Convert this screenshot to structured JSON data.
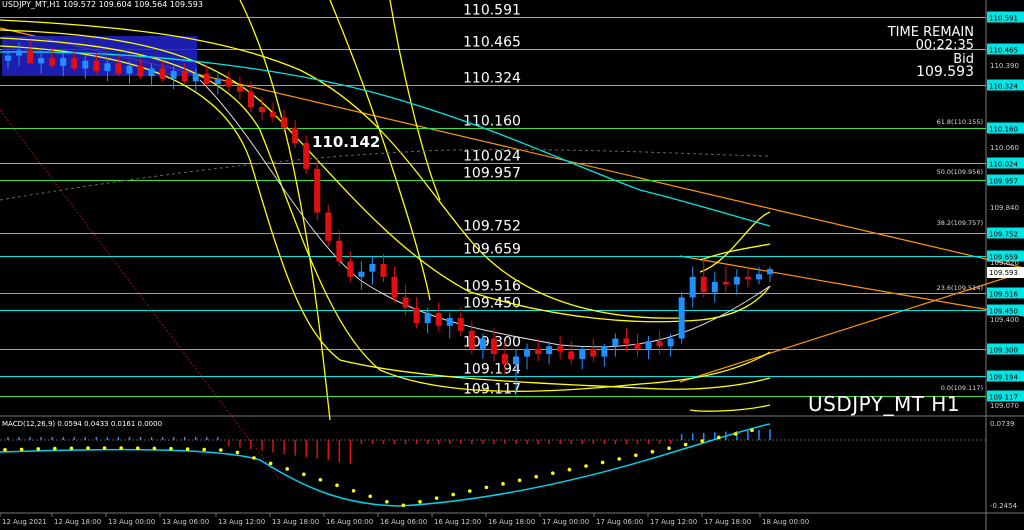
{
  "header": {
    "title": "USDJPY_MT,H1  109.572 109.604 109.564 109.593"
  },
  "info": {
    "time_remain_label": "TIME REMAIN",
    "time_remain_value": "00:22:35",
    "bid_label": "Bid",
    "bid_value": "109.593"
  },
  "watermark": "USDJPY_MT H1",
  "callout": "110.142",
  "colors": {
    "bg": "#000000",
    "bull": "#1e90ff",
    "bear": "#e01010",
    "level": "#00e5e5",
    "green": "#40e040",
    "yellow": "#ffff00",
    "orange": "#ff9900",
    "macd_line": "#00cfe8",
    "signal": "#ffff00",
    "text": "#ffffff"
  },
  "chart_data": {
    "type": "candlestick",
    "symbol": "USDJPY_MT",
    "timeframe": "H1",
    "ylim": [
      109.07,
      110.59
    ],
    "price_ticks": [
      "110.591",
      "110.465",
      "110.390",
      "110.324",
      "110.160",
      "110.155",
      "110.060",
      "110.024",
      "109.957",
      "109.956",
      "109.840",
      "109.752",
      "109.757",
      "109.659",
      "109.620",
      "109.593",
      "109.516",
      "109.450",
      "109.400",
      "109.300",
      "109.194",
      "109.117",
      "109.070"
    ],
    "x_ticks": [
      "12 Aug 2021",
      "12 Aug 18:00",
      "13 Aug 00:00",
      "13 Aug 06:00",
      "13 Aug 12:00",
      "13 Aug 18:00",
      "16 Aug 00:00",
      "16 Aug 06:00",
      "16 Aug 12:00",
      "16 Aug 18:00",
      "17 Aug 00:00",
      "17 Aug 06:00",
      "17 Aug 12:00",
      "17 Aug 18:00",
      "18 Aug 00:00"
    ],
    "levels": [
      {
        "price": 110.591,
        "label": "110.591",
        "color": "#00e5e5"
      },
      {
        "price": 110.465,
        "label": "110.465",
        "color": "#00e5e5"
      },
      {
        "price": 110.324,
        "label": "110.324",
        "color": "#00e5e5"
      },
      {
        "price": 110.16,
        "label": "110.160",
        "color": "#40e040"
      },
      {
        "price": 110.024,
        "label": "110.024",
        "color": "#00e5e5"
      },
      {
        "price": 109.957,
        "label": "109.957",
        "color": "#40e040"
      },
      {
        "price": 109.752,
        "label": "109.752",
        "color": "#40e040"
      },
      {
        "price": 109.659,
        "label": "109.659",
        "color": "#00e5e5"
      },
      {
        "price": 109.516,
        "label": "109.516",
        "color": "#40e040"
      },
      {
        "price": 109.45,
        "label": "109.450",
        "color": "#00e5e5"
      },
      {
        "price": 109.3,
        "label": "109.300",
        "color": "#00e5e5"
      },
      {
        "price": 109.194,
        "label": "109.194",
        "color": "#00e5e5"
      },
      {
        "price": 109.117,
        "label": "109.117",
        "color": "#40e040"
      }
    ],
    "fib_labels": [
      "61.8(110.155)",
      "50.0(109.956)",
      "38.2(109.757)",
      "23.6(109.514)",
      "0.0(109.117)"
    ],
    "candles_ohlc": [
      [
        110.42,
        110.46,
        110.39,
        110.44
      ],
      [
        110.44,
        110.49,
        110.4,
        110.46
      ],
      [
        110.46,
        110.5,
        110.42,
        110.41
      ],
      [
        110.41,
        110.46,
        110.37,
        110.43
      ],
      [
        110.43,
        110.47,
        110.39,
        110.4
      ],
      [
        110.4,
        110.45,
        110.36,
        110.43
      ],
      [
        110.43,
        110.46,
        110.38,
        110.39
      ],
      [
        110.39,
        110.44,
        110.35,
        110.42
      ],
      [
        110.42,
        110.45,
        110.37,
        110.38
      ],
      [
        110.38,
        110.43,
        110.34,
        110.41
      ],
      [
        110.41,
        110.44,
        110.36,
        110.37
      ],
      [
        110.37,
        110.42,
        110.33,
        110.4
      ],
      [
        110.4,
        110.43,
        110.35,
        110.36
      ],
      [
        110.36,
        110.41,
        110.32,
        110.39
      ],
      [
        110.39,
        110.42,
        110.34,
        110.35
      ],
      [
        110.35,
        110.4,
        110.31,
        110.38
      ],
      [
        110.38,
        110.41,
        110.33,
        110.34
      ],
      [
        110.34,
        110.39,
        110.3,
        110.37
      ],
      [
        110.37,
        110.4,
        110.32,
        110.33
      ],
      [
        110.33,
        110.37,
        110.29,
        110.35
      ],
      [
        110.35,
        110.38,
        110.3,
        110.32
      ],
      [
        110.32,
        110.36,
        110.27,
        110.3
      ],
      [
        110.3,
        110.34,
        110.22,
        110.24
      ],
      [
        110.24,
        110.28,
        110.19,
        110.22
      ],
      [
        110.22,
        110.26,
        110.18,
        110.2
      ],
      [
        110.2,
        110.23,
        110.14,
        110.16
      ],
      [
        110.16,
        110.19,
        110.08,
        110.1
      ],
      [
        110.1,
        110.13,
        109.98,
        110.0
      ],
      [
        110.0,
        110.04,
        109.8,
        109.83
      ],
      [
        109.83,
        109.86,
        109.7,
        109.72
      ],
      [
        109.72,
        109.76,
        109.62,
        109.64
      ],
      [
        109.64,
        109.68,
        109.56,
        109.58
      ],
      [
        109.58,
        109.64,
        109.53,
        109.6
      ],
      [
        109.6,
        109.66,
        109.55,
        109.63
      ],
      [
        109.63,
        109.67,
        109.56,
        109.58
      ],
      [
        109.58,
        109.62,
        109.48,
        109.5
      ],
      [
        109.5,
        109.55,
        109.43,
        109.46
      ],
      [
        109.46,
        109.5,
        109.38,
        109.4
      ],
      [
        109.4,
        109.46,
        109.36,
        109.44
      ],
      [
        109.44,
        109.48,
        109.37,
        109.39
      ],
      [
        109.39,
        109.44,
        109.34,
        109.42
      ],
      [
        109.42,
        109.46,
        109.35,
        109.37
      ],
      [
        109.37,
        109.41,
        109.28,
        109.3
      ],
      [
        109.3,
        109.36,
        109.26,
        109.34
      ],
      [
        109.34,
        109.38,
        109.25,
        109.28
      ],
      [
        109.28,
        109.33,
        109.2,
        109.24
      ],
      [
        109.24,
        109.3,
        109.12,
        109.27
      ],
      [
        109.27,
        109.32,
        109.22,
        109.3
      ],
      [
        109.3,
        109.34,
        109.25,
        109.28
      ],
      [
        109.28,
        109.33,
        109.24,
        109.31
      ],
      [
        109.31,
        109.35,
        109.26,
        109.29
      ],
      [
        109.29,
        109.33,
        109.24,
        109.26
      ],
      [
        109.26,
        109.31,
        109.22,
        109.3
      ],
      [
        109.3,
        109.34,
        109.25,
        109.27
      ],
      [
        109.27,
        109.32,
        109.23,
        109.31
      ],
      [
        109.31,
        109.36,
        109.27,
        109.34
      ],
      [
        109.34,
        109.38,
        109.29,
        109.32
      ],
      [
        109.32,
        109.36,
        109.27,
        109.3
      ],
      [
        109.3,
        109.35,
        109.26,
        109.33
      ],
      [
        109.33,
        109.37,
        109.28,
        109.31
      ],
      [
        109.31,
        109.36,
        109.27,
        109.34
      ],
      [
        109.34,
        109.52,
        109.32,
        109.5
      ],
      [
        109.5,
        109.62,
        109.46,
        109.58
      ],
      [
        109.58,
        109.65,
        109.5,
        109.52
      ],
      [
        109.52,
        109.6,
        109.48,
        109.56
      ],
      [
        109.56,
        109.62,
        109.52,
        109.55
      ],
      [
        109.55,
        109.61,
        109.51,
        109.58
      ],
      [
        109.58,
        109.62,
        109.54,
        109.57
      ],
      [
        109.57,
        109.62,
        109.55,
        109.59
      ],
      [
        109.59,
        109.62,
        109.56,
        109.61
      ]
    ],
    "indicator": {
      "name": "MACD(12,26,9)",
      "values_shown": [
        "0.0594",
        "0.0433",
        "0.0161",
        "0.0000"
      ],
      "y_ticks": [
        "0.0739",
        "-0.2454"
      ],
      "ylim": [
        -0.2454,
        0.0739
      ]
    }
  }
}
